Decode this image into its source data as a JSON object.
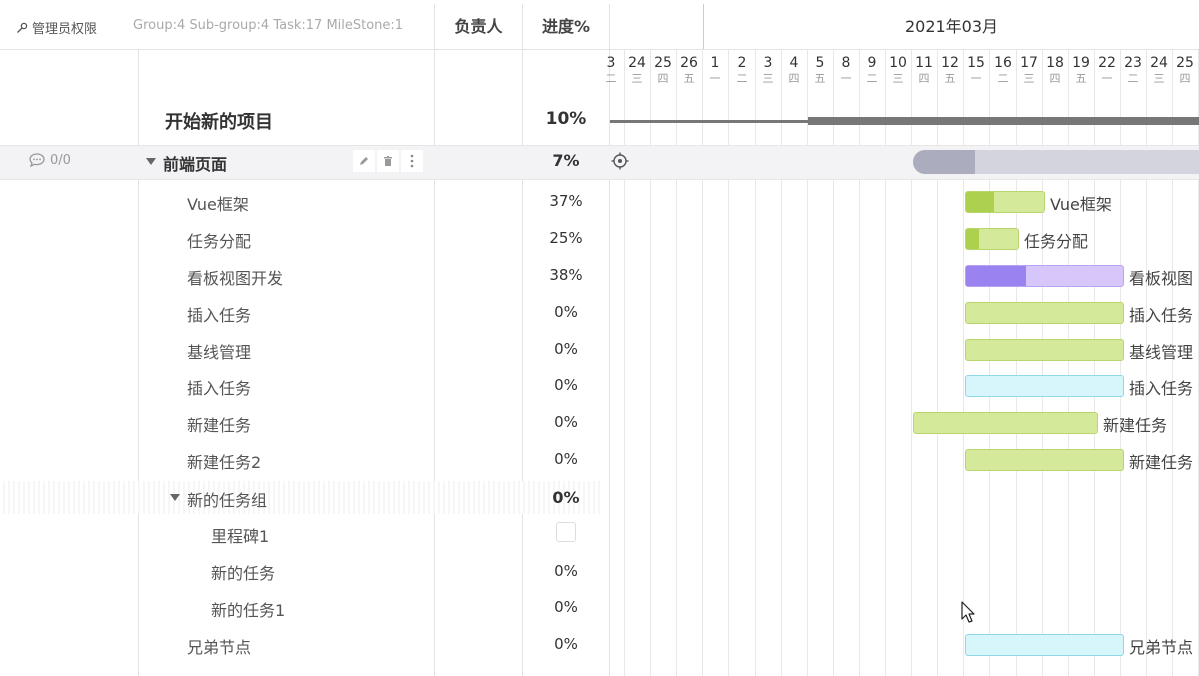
{
  "header": {
    "permission_label": "管理员权限",
    "stats": "Group:4 Sub-group:4 Task:17 MileStone:1",
    "col_owner": "负责人",
    "col_progress": "进度%",
    "month": "2021年03月"
  },
  "days": [
    {
      "d": "3",
      "w": "二"
    },
    {
      "d": "24",
      "w": "三"
    },
    {
      "d": "25",
      "w": "四"
    },
    {
      "d": "26",
      "w": "五"
    },
    {
      "d": "1",
      "w": "一"
    },
    {
      "d": "2",
      "w": "二"
    },
    {
      "d": "3",
      "w": "三"
    },
    {
      "d": "4",
      "w": "四"
    },
    {
      "d": "5",
      "w": "五"
    },
    {
      "d": "8",
      "w": "一"
    },
    {
      "d": "9",
      "w": "二"
    },
    {
      "d": "10",
      "w": "三"
    },
    {
      "d": "11",
      "w": "四"
    },
    {
      "d": "12",
      "w": "五"
    },
    {
      "d": "15",
      "w": "一"
    },
    {
      "d": "16",
      "w": "二"
    },
    {
      "d": "17",
      "w": "三"
    },
    {
      "d": "18",
      "w": "四"
    },
    {
      "d": "19",
      "w": "五"
    },
    {
      "d": "22",
      "w": "一"
    },
    {
      "d": "23",
      "w": "二"
    },
    {
      "d": "24",
      "w": "三"
    },
    {
      "d": "25",
      "w": "四"
    }
  ],
  "project": {
    "name": "开始新的项目",
    "progress": "10%"
  },
  "group": {
    "comments": "0/0",
    "name": "前端页面",
    "progress": "7%"
  },
  "tasks": [
    {
      "name": "Vue框架",
      "progress": "37%",
      "bar_label": "Vue框架"
    },
    {
      "name": "任务分配",
      "progress": "25%",
      "bar_label": "任务分配"
    },
    {
      "name": "看板视图开发",
      "progress": "38%",
      "bar_label": "看板视图"
    },
    {
      "name": "插入任务",
      "progress": "0%",
      "bar_label": "插入任务"
    },
    {
      "name": "基线管理",
      "progress": "0%",
      "bar_label": "基线管理"
    },
    {
      "name": "插入任务",
      "progress": "0%",
      "bar_label": "插入任务"
    },
    {
      "name": "新建任务",
      "progress": "0%",
      "bar_label": "新建任务"
    },
    {
      "name": "新建任务2",
      "progress": "0%",
      "bar_label": "新建任务"
    }
  ],
  "subgroup": {
    "name": "新的任务组",
    "progress": "0%"
  },
  "subtasks": [
    {
      "name": "里程碑1",
      "progress": ""
    },
    {
      "name": "新的任务",
      "progress": "0%"
    },
    {
      "name": "新的任务1",
      "progress": "0%"
    }
  ],
  "sibling": {
    "name": "兄弟节点",
    "progress": "0%",
    "bar_label": "兄弟节点"
  },
  "colors": {
    "green": "#d4e99a",
    "green_dark": "#aed04f",
    "purple": "#d6c6fa",
    "purple_dark": "#9a82f0",
    "cyan": "#d6f6fb",
    "gray_bar": "#d3d4de"
  }
}
